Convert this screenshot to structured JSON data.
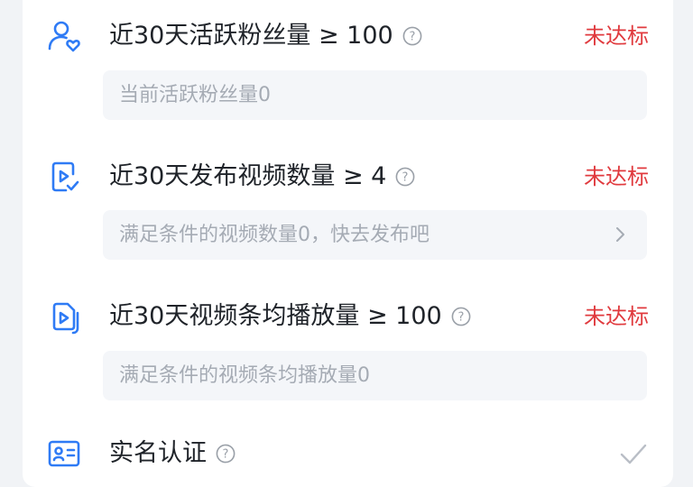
{
  "requirements": [
    {
      "icon": "follower-heart-icon",
      "title": "近30天活跃粉丝量 ≥ 100",
      "status": "未达标",
      "detail": "当前活跃粉丝量0",
      "has_arrow": false
    },
    {
      "icon": "video-publish-icon",
      "title": "近30天发布视频数量 ≥ 4",
      "status": "未达标",
      "detail": "满足条件的视频数量0，快去发布吧",
      "has_arrow": true
    },
    {
      "icon": "video-play-count-icon",
      "title": "近30天视频条均播放量 ≥ 100",
      "status": "未达标",
      "detail": "满足条件的视频条均播放量0",
      "has_arrow": false
    },
    {
      "icon": "id-card-icon",
      "title": "实名认证",
      "status": "",
      "status_icon": "check-icon"
    }
  ],
  "colors": {
    "accent": "#2f7bf5",
    "fail": "#e03a3e",
    "box": "#f4f6f9",
    "muted_text": "#a5abb4"
  }
}
